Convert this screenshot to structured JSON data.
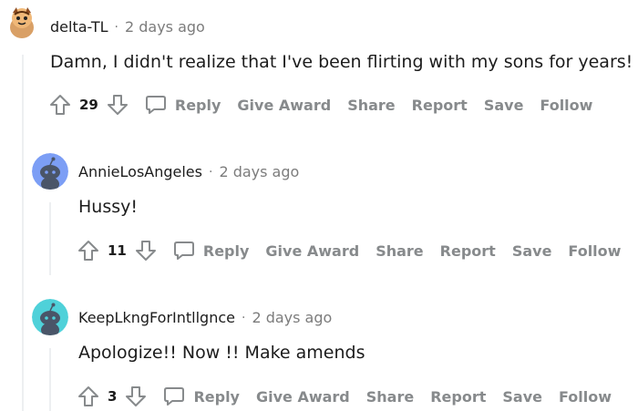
{
  "comments": [
    {
      "author": "delta-TL",
      "time": "2 days ago",
      "body": "Damn, I didn't realize that I've been flirting with my sons for years!",
      "score": "29",
      "avatar_color": "#f4a261",
      "actions": {
        "reply": "Reply",
        "award": "Give Award",
        "share": "Share",
        "report": "Report",
        "save": "Save",
        "follow": "Follow"
      }
    },
    {
      "author": "AnnieLosAngeles",
      "time": "2 days ago",
      "body": "Hussy!",
      "score": "11",
      "avatar_color": "#7c9ef5",
      "actions": {
        "reply": "Reply",
        "award": "Give Award",
        "share": "Share",
        "report": "Report",
        "save": "Save",
        "follow": "Follow"
      }
    },
    {
      "author": "KeepLkngForIntllgnce",
      "time": "2 days ago",
      "body": "Apologize!! Now !! Make amends",
      "score": "3",
      "avatar_color": "#4fd1d9",
      "actions": {
        "reply": "Reply",
        "award": "Give Award",
        "share": "Share",
        "report": "Report",
        "save": "Save",
        "follow": "Follow"
      }
    }
  ]
}
